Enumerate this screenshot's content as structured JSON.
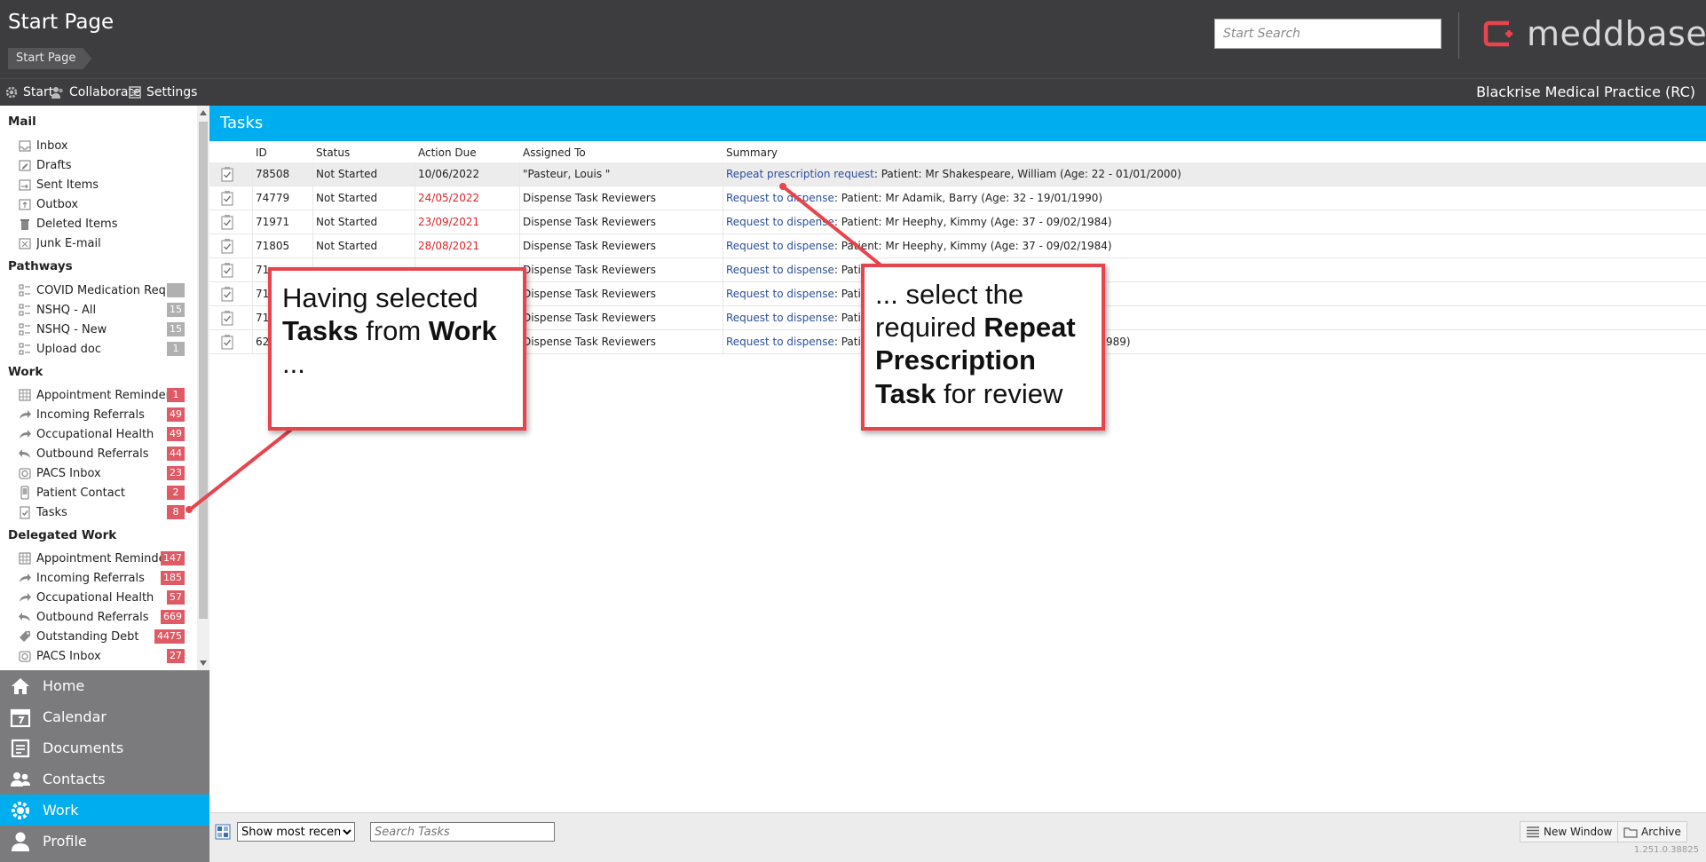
{
  "header": {
    "title": "Start Page",
    "breadcrumb": "Start Page",
    "search_placeholder": "Start Search",
    "logo_text": "meddbase"
  },
  "menubar": {
    "items": [
      {
        "label": "Start",
        "icon": "gear-icon"
      },
      {
        "label": "Collaborate",
        "icon": "people-icon"
      },
      {
        "label": "Settings",
        "icon": "settings-doc-icon"
      }
    ],
    "practice": "Blackrise Medical Practice (RC)"
  },
  "sidebar": {
    "mail": {
      "title": "Mail",
      "items": [
        "Inbox",
        "Drafts",
        "Sent Items",
        "Outbox",
        "Deleted Items",
        "Junk E-mail"
      ]
    },
    "pathways": {
      "title": "Pathways",
      "items": [
        {
          "label": "COVID Medication Request",
          "count": ""
        },
        {
          "label": "NSHQ - All",
          "count": "15"
        },
        {
          "label": "NSHQ - New",
          "count": "15"
        },
        {
          "label": "Upload doc",
          "count": "1"
        }
      ]
    },
    "work": {
      "title": "Work",
      "items": [
        {
          "label": "Appointment Reminder",
          "count": "1"
        },
        {
          "label": "Incoming Referrals",
          "count": "49"
        },
        {
          "label": "Occupational Health",
          "count": "49"
        },
        {
          "label": "Outbound Referrals",
          "count": "44"
        },
        {
          "label": "PACS Inbox",
          "count": "23"
        },
        {
          "label": "Patient Contact",
          "count": "2"
        },
        {
          "label": "Tasks",
          "count": "8"
        }
      ]
    },
    "delegated": {
      "title": "Delegated Work",
      "items": [
        {
          "label": "Appointment Reminder",
          "count": "147"
        },
        {
          "label": "Incoming Referrals",
          "count": "185"
        },
        {
          "label": "Occupational Health",
          "count": "57"
        },
        {
          "label": "Outbound Referrals",
          "count": "669"
        },
        {
          "label": "Outstanding Debt",
          "count": "4475"
        },
        {
          "label": "PACS Inbox",
          "count": "27"
        }
      ]
    }
  },
  "nav": {
    "items": [
      "Home",
      "Calendar",
      "Documents",
      "Contacts",
      "Work",
      "Profile"
    ],
    "active": "Work"
  },
  "tasks": {
    "title": "Tasks",
    "columns": [
      "ID",
      "Status",
      "Action Due",
      "Assigned To",
      "Summary"
    ],
    "rows": [
      {
        "id": "78508",
        "status": "Not Started",
        "due": "10/06/2022",
        "due_overdue": false,
        "assigned": "\"Pasteur, Louis \"",
        "summary_link": "Repeat prescription request",
        "summary_rest": ": Patient: Mr Shakespeare, William (Age: 22 - 01/01/2000)"
      },
      {
        "id": "74779",
        "status": "Not Started",
        "due": "24/05/2022",
        "due_overdue": true,
        "assigned": "Dispense Task Reviewers",
        "summary_link": "Request to dispense",
        "summary_rest": ": Patient: Mr Adamik, Barry (Age: 32 - 19/01/1990)"
      },
      {
        "id": "71971",
        "status": "Not Started",
        "due": "23/09/2021",
        "due_overdue": true,
        "assigned": "Dispense Task Reviewers",
        "summary_link": "Request to dispense",
        "summary_rest": ": Patient: Mr Heephy, Kimmy (Age: 37 - 09/02/1984)"
      },
      {
        "id": "71805",
        "status": "Not Started",
        "due": "28/08/2021",
        "due_overdue": true,
        "assigned": "Dispense Task Reviewers",
        "summary_link": "Request to dispense",
        "summary_rest": ": Patient: Mr Heephy, Kimmy (Age: 37 - 09/02/1984)"
      },
      {
        "id": "71",
        "status": "",
        "due": "",
        "due_overdue": false,
        "assigned": "Dispense Task Reviewers",
        "summary_link": "Request to dispense",
        "summary_rest": ": Patient"
      },
      {
        "id": "71",
        "status": "",
        "due": "",
        "due_overdue": false,
        "assigned": "Dispense Task Reviewers",
        "summary_link": "Request to dispense",
        "summary_rest": ": Patient"
      },
      {
        "id": "71",
        "status": "",
        "due": "",
        "due_overdue": false,
        "assigned": "Dispense Task Reviewers",
        "summary_link": "Request to dispense",
        "summary_rest": ": Patient"
      },
      {
        "id": "62",
        "status": "",
        "due": "",
        "due_overdue": false,
        "assigned": "Dispense Task Reviewers",
        "summary_link": "Request to dispense",
        "summary_rest": ": Patient"
      }
    ],
    "row8_tail": "989)"
  },
  "toolbar": {
    "filter_selected": "Show most recent",
    "search_placeholder": "Search Tasks",
    "new_window": "New Window",
    "archive": "Archive",
    "version": "1.251.0.38825"
  },
  "callouts": {
    "left": {
      "t1": "Having selected ",
      "b1": "Tasks",
      "t2": " from ",
      "b2": "Work",
      "t3": " ..."
    },
    "right": {
      "t1": "... select the required ",
      "b1": "Repeat Prescription Task",
      "t2": " for review"
    }
  },
  "colors": {
    "header_bg": "#3d3d3f",
    "accent": "#00aeef",
    "badge": "#e05a66",
    "overdue": "#e0242b",
    "link": "#2b4f9e",
    "callout_border": "#e8444d",
    "logo_red": "#e8444d"
  }
}
